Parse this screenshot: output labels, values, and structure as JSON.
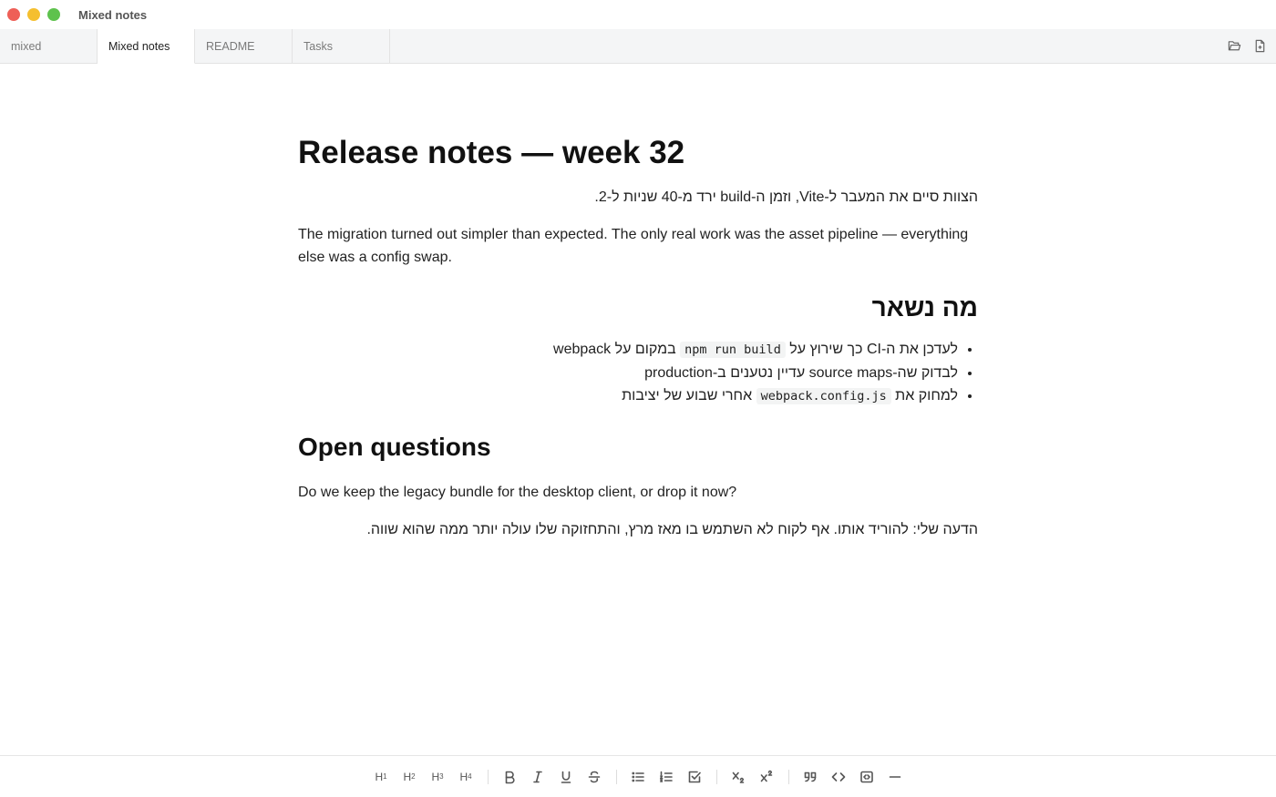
{
  "window": {
    "title": "Mixed notes",
    "colors": {
      "close": "#ee5f57",
      "minimize": "#f5bf2f",
      "zoom": "#5ec24d"
    }
  },
  "tabs": [
    {
      "label": "mixed",
      "active": false
    },
    {
      "label": "Mixed notes",
      "active": true
    },
    {
      "label": "README",
      "active": false
    },
    {
      "label": "Tasks",
      "active": false
    }
  ],
  "tab_actions": [
    {
      "icon": "folder-open-icon"
    },
    {
      "icon": "new-file-icon"
    }
  ],
  "document": {
    "title": "Release notes — week 32",
    "intro_he": "הצוות סיים את המעבר ל-Vite, וזמן ה-build ירד מ-40 שניות ל-2.",
    "paragraph_en": "The migration turned out simpler than expected. The only real work was the asset pipeline — everything else was a config swap.",
    "heading_he": "מה נשאר",
    "list": [
      {
        "before": "לעדכן את ה-CI כך שירוץ על ",
        "code": "npm run build",
        "after": " במקום על webpack"
      },
      {
        "text": "לבדוק שה-source maps עדיין נטענים ב-production"
      },
      {
        "before": "למחוק את ",
        "code": "webpack.config.js",
        "after": " אחרי שבוע של יציבות"
      }
    ],
    "heading_en": "Open questions",
    "question_en": "Do we keep the legacy bundle for the desktop client, or drop it now?",
    "opinion_he": "הדעה שלי: להוריד אותו. אף לקוח לא השתמש בו מאז מרץ, והתחזוקה שלו עולה יותר ממה שהוא שווה."
  },
  "toolbar": {
    "headings": [
      {
        "label": "H",
        "level": "1"
      },
      {
        "label": "H",
        "level": "2"
      },
      {
        "label": "H",
        "level": "3"
      },
      {
        "label": "H",
        "level": "4"
      }
    ],
    "icons": [
      "bold-icon",
      "italic-icon",
      "underline-icon",
      "strikethrough-icon",
      "bullet-list-icon",
      "ordered-list-icon",
      "task-list-icon",
      "subscript-icon",
      "superscript-icon",
      "blockquote-icon",
      "code-icon",
      "code-block-icon",
      "horizontal-rule-icon"
    ]
  }
}
